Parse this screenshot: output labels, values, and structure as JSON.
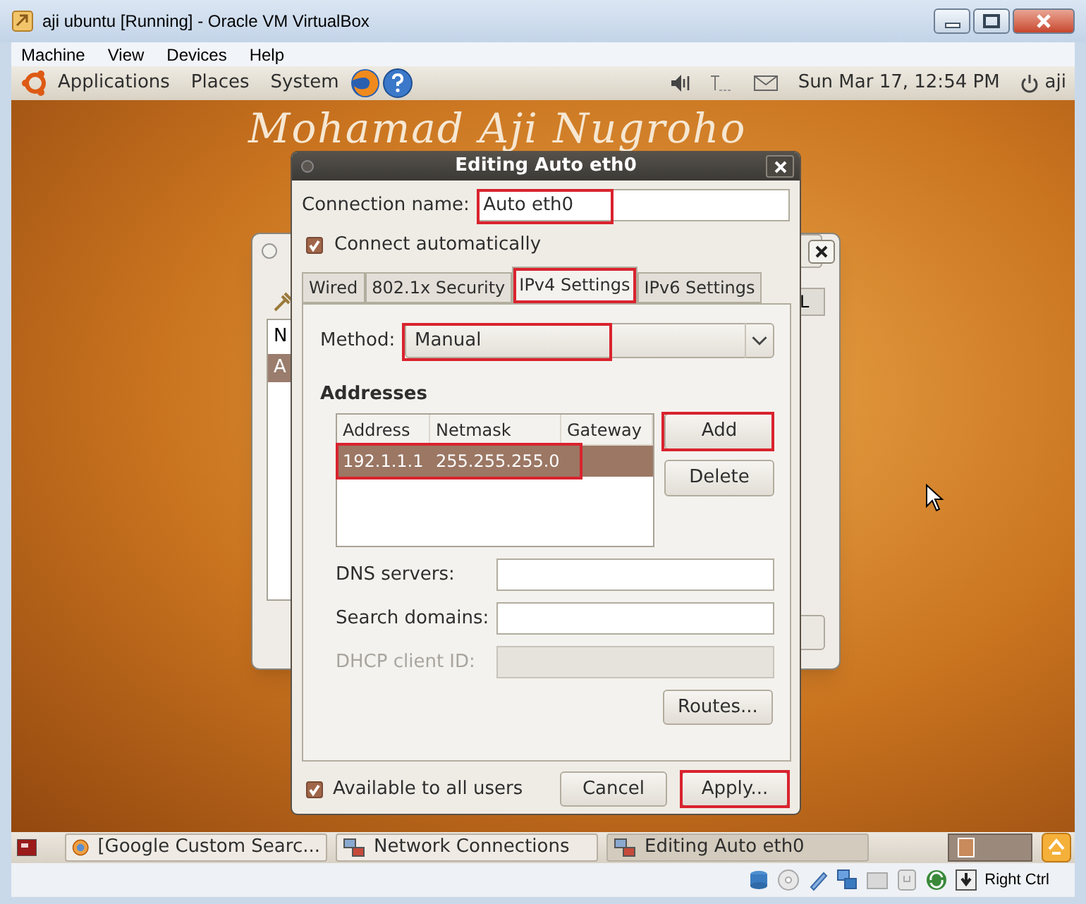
{
  "window": {
    "title": "aji ubuntu [Running] - Oracle VM VirtualBox"
  },
  "menu": [
    "Machine",
    "View",
    "Devices",
    "Help"
  ],
  "top_panel": {
    "menus": [
      "Applications",
      "Places",
      "System"
    ],
    "clock": "Sun Mar 17, 12:54 PM",
    "user": "aji"
  },
  "desktop": {
    "banner": "Mohamad Aji Nugroho"
  },
  "background_window": {
    "tab_fragment": "L",
    "list_header_fragment": "N",
    "row_fragment": "A"
  },
  "dialog": {
    "title": "Editing Auto eth0",
    "connection_name": {
      "label": "Connection name:",
      "value": "Auto eth0",
      "highlighted": true
    },
    "connect_automatically": {
      "label": "Connect automatically",
      "checked": true
    },
    "tabs": [
      {
        "label": "Wired",
        "selected": false,
        "highlighted": false
      },
      {
        "label": "802.1x Security",
        "selected": false,
        "highlighted": false
      },
      {
        "label": "IPv4 Settings",
        "selected": true,
        "highlighted": true
      },
      {
        "label": "IPv6 Settings",
        "selected": false,
        "highlighted": false
      }
    ],
    "method": {
      "label": "Method:",
      "value": "Manual",
      "highlighted": true
    },
    "addresses": {
      "heading": "Addresses",
      "columns": [
        "Address",
        "Netmask",
        "Gateway"
      ],
      "rows": [
        {
          "cells": [
            "192.1.1.1",
            "255.255.255.0"
          ],
          "selected": true,
          "highlighted": true
        }
      ],
      "buttons": [
        {
          "label": "Add",
          "highlighted": true
        },
        {
          "label": "Delete",
          "highlighted": false
        }
      ]
    },
    "fields": [
      {
        "label": "DNS servers:",
        "disabled": false
      },
      {
        "label": "Search domains:",
        "disabled": false
      },
      {
        "label": "DHCP client ID:",
        "disabled": true
      }
    ],
    "routes_button": "Routes...",
    "available_to_all": {
      "label": "Available to all users",
      "checked": true
    },
    "buttons": [
      {
        "label": "Cancel",
        "highlighted": false
      },
      {
        "label": "Apply...",
        "highlighted": true
      }
    ]
  },
  "taskbar": {
    "tasks": [
      {
        "label": "[Google Custom Searc...",
        "kind": "browser",
        "selected": false
      },
      {
        "label": "Network Connections",
        "kind": "network",
        "selected": false
      },
      {
        "label": "Editing Auto eth0",
        "kind": "network",
        "selected": true
      }
    ]
  },
  "status_bar": {
    "host_key": "Right Ctrl"
  }
}
